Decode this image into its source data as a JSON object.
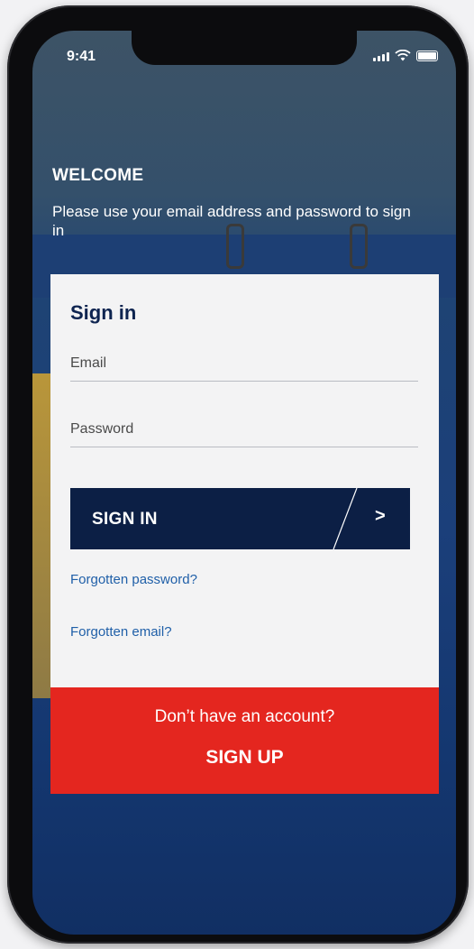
{
  "status_bar": {
    "time": "9:41"
  },
  "welcome": {
    "title": "WELCOME",
    "message": "Please use your email address and password to sign in"
  },
  "signin_card": {
    "title": "Sign in",
    "email_placeholder": "Email",
    "password_placeholder": "Password",
    "signin_button": "SIGN IN",
    "signin_arrow": ">",
    "forgot_password": "Forgotten password?",
    "forgot_email": "Forgotten email?"
  },
  "signup": {
    "prompt": "Don’t have an account?",
    "button": "SIGN UP"
  },
  "colors": {
    "navy": "#0c1f45",
    "red": "#e4261f",
    "link": "#1f5fa8"
  }
}
